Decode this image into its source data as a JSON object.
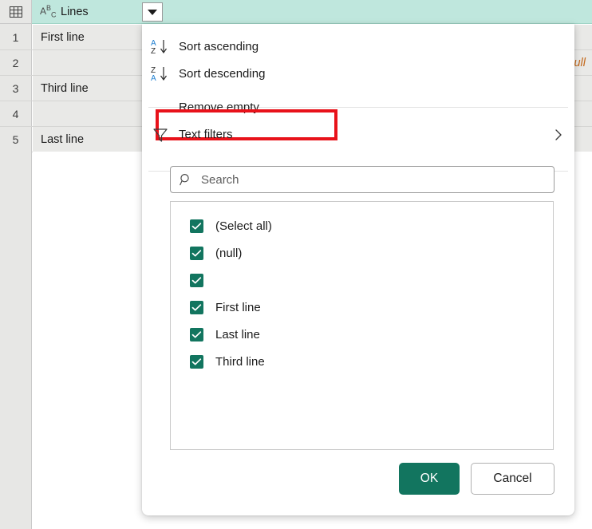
{
  "grid": {
    "corner_icon": "table-grid-icon",
    "column": {
      "type_indicator": "ABC",
      "type_sup": "B",
      "type_main_a": "A",
      "type_sub": "C",
      "name": "Lines",
      "dropdown_icon": "caret-down-icon"
    },
    "rows": [
      {
        "number": "1",
        "value": "First line",
        "is_null": false
      },
      {
        "number": "2",
        "value": "null",
        "is_null": true
      },
      {
        "number": "3",
        "value": "Third line",
        "is_null": false
      },
      {
        "number": "4",
        "value": "",
        "is_null": false
      },
      {
        "number": "5",
        "value": "Last line",
        "is_null": false
      }
    ]
  },
  "popup": {
    "menu": [
      {
        "label": "Sort ascending",
        "icon": "sort-ascending-az-icon"
      },
      {
        "label": "Sort descending",
        "icon": "sort-descending-za-icon"
      },
      {
        "label": "Remove empty",
        "icon": "none"
      },
      {
        "label": "Text filters",
        "icon": "filter-funnel-icon",
        "chevron": "chevron-right-icon"
      }
    ],
    "highlight_color": "#e8121a",
    "search": {
      "placeholder": "Search",
      "value": "",
      "icon": "search-icon"
    },
    "filter_list": [
      {
        "label": "(Select all)",
        "checked": true
      },
      {
        "label": "(null)",
        "checked": true
      },
      {
        "label": "",
        "checked": true
      },
      {
        "label": "First line",
        "checked": true
      },
      {
        "label": "Last line",
        "checked": true
      },
      {
        "label": "Third line",
        "checked": true
      }
    ],
    "buttons": {
      "ok": "OK",
      "cancel": "Cancel"
    },
    "accent_color": "#12755f",
    "header_color": "#bfe7dd"
  }
}
